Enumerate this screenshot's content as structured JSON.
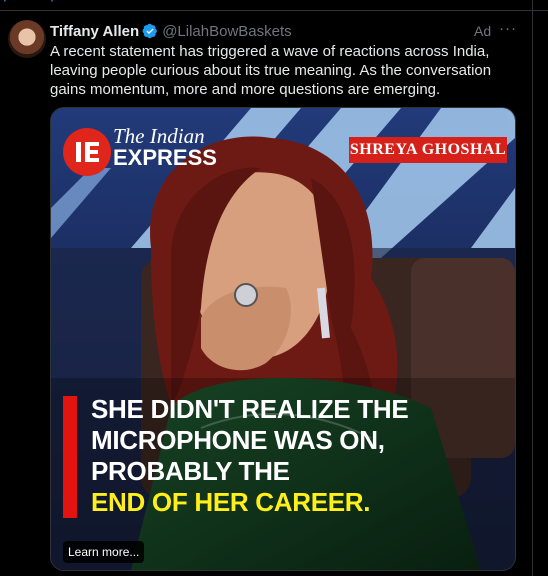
{
  "tweet": {
    "author_name": "Tiffany Allen",
    "handle": "@LilahBowBaskets",
    "ad_label": "Ad",
    "more": "···",
    "text": "A recent statement has triggered a wave of reactions across India, leaving people curious about its true meaning. As the conversation gains momentum, more and more questions are emerging."
  },
  "media": {
    "logo_line1": "The Indian",
    "logo_line2": "EXPRESS",
    "name_tag": "SHREYA GHOSHAL",
    "headline_line1": "SHE DIDN'T REALIZE THE",
    "headline_line2": "MICROPHONE WAS ON,",
    "headline_line3": "PROBABLY THE",
    "headline_line4": "END OF HER CAREER.",
    "learn_more": "Learn more..."
  },
  "colors": {
    "accent": "#1d9bf0",
    "brand_red": "#e0251b",
    "headline_yellow": "#ffef1a"
  }
}
